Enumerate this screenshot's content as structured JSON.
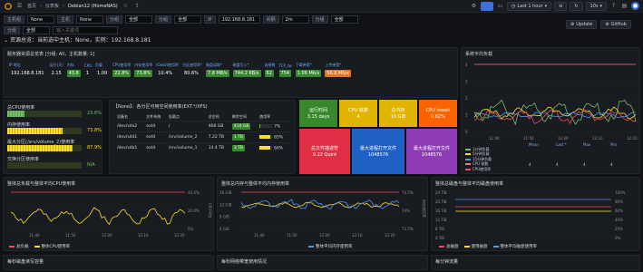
{
  "topbar": {
    "crumbs": [
      "首页",
      "仪表板",
      "Debian12 (HomeNAS)"
    ],
    "time_range": "Last 1 hour",
    "zoom": "",
    "refresh": "10s"
  },
  "variables": [
    {
      "label": "主机组",
      "value": "None"
    },
    {
      "label": "主机",
      "value": "None"
    },
    {
      "label": "分组",
      "value": "全部"
    },
    {
      "label": "分组",
      "value": "全部"
    },
    {
      "label": "IP",
      "value": "192.168.8.181"
    },
    {
      "label": "间隔",
      "value": "2m"
    },
    {
      "label": "分组",
      "value": "全部"
    },
    {
      "label": "分组",
      "value": "全部"
    }
  ],
  "search_placeholder": "输入关键词",
  "row1_title": "资源总览：当前选中主机：None，实例：192.168.8.181",
  "right_buttons": {
    "update": "Update",
    "github": "GitHub"
  },
  "resource_panel": {
    "title": "服务器资源总览表 [分组: All，主机数量: 1]",
    "headers": [
      "IP 地址",
      "运行(天)",
      "内存",
      "CPU",
      "负载",
      "CPU使用率",
      "内存使用率",
      "IOwait使用率",
      "分区使用率*",
      "磁盘读取*",
      "磁盘写入*",
      "连接数",
      "TCP_tw",
      "下载带宽*",
      "上传带宽*"
    ],
    "row": [
      "192.168.8.181",
      "2.15",
      "43.8",
      "1",
      "1.00",
      "22.8%",
      "73.8%",
      "10.4%",
      "80.6%",
      "7.8 MB/s",
      "744.2 KB/s",
      "62",
      "754",
      "1.06 Mb/s",
      "56.8 Mb/s"
    ]
  },
  "overall_panel": {
    "title": "整体资源使用率",
    "bars": [
      {
        "label": "总CPU使用率",
        "value": "23.6%",
        "pct": 23.6,
        "color": "#73bf69"
      },
      {
        "label": "内存使用率",
        "value": "73.8%",
        "pct": 73.8,
        "color": "#fade2a"
      },
      {
        "label": "最大分区(/srv/volume_2)使用率",
        "value": "87.9%",
        "pct": 87.9,
        "color": "#fade2a"
      },
      {
        "label": "交换分区使用率",
        "value": "N/A",
        "pct": 0,
        "color": "#73bf69"
      }
    ]
  },
  "disk_panel": {
    "title": "【None】：各分区可用空间使用率(EXT.*/XFS)",
    "headers": [
      "设备名",
      "文件系统",
      "挂载点",
      "总空间",
      "剩余空间",
      "使用率"
    ],
    "rows": [
      {
        "dev": "/dev/sda2",
        "fs": "ext4",
        "mount": "/",
        "total": "468 GB",
        "free": "410 GB",
        "used": "7%",
        "pct": 7,
        "color": "#73bf69"
      },
      {
        "dev": "/dev/sdd1",
        "fs": "ext4",
        "mount": "/srv/volume_2",
        "total": "7.22 TB",
        "free": "1 TB",
        "used": "85%",
        "pct": 85,
        "color": "#fade2a"
      },
      {
        "dev": "/dev/sdb1",
        "fs": "ext4",
        "mount": "/srv/volume_1",
        "total": "14.4 TB",
        "free": "3 TB",
        "used": "84%",
        "pct": 84,
        "color": "#fade2a"
      }
    ]
  },
  "tiles": [
    {
      "label": "运行时间",
      "value": "3.15 days",
      "color": "#37872d"
    },
    {
      "label": "CPU 核数",
      "value": "4",
      "color": "#e0b400"
    },
    {
      "label": "总内存",
      "value": "16 GiB",
      "color": "#e0b400"
    },
    {
      "label": "CPU iowait",
      "value": "0.62%",
      "color": "#fa6400"
    },
    {
      "label": "总文件描述符",
      "value": "9.22 Quint",
      "color": "#e02f44"
    },
    {
      "label": "最大进程打开文件",
      "value": "1048576",
      "color": "#1f60c4"
    },
    {
      "label": "最大进程打开文件",
      "value": "1048576",
      "color": "#8f3bb8"
    }
  ],
  "load_panel": {
    "title": "系统平均负载",
    "yticks": [
      "4",
      "3",
      "2",
      "1",
      "0"
    ],
    "xticks": [
      "11:40",
      "11:50",
      "12:00",
      "12:10",
      "12:20"
    ],
    "legend_headers": [
      "Mean",
      "Last *",
      "Max",
      "Min"
    ],
    "legend": [
      {
        "name": "1分钟负载",
        "color": "#73bf69",
        "vals": [
          "",
          "",
          "",
          ""
        ]
      },
      {
        "name": "5分钟负载",
        "color": "#fade2a",
        "vals": [
          "",
          "",
          "",
          ""
        ]
      },
      {
        "name": "15分钟负载",
        "color": "#5794f2",
        "vals": [
          "",
          "",
          "",
          ""
        ]
      },
      {
        "name": "CPU 核数",
        "color": "#ff7383",
        "vals": [
          "4",
          "4",
          "4",
          "4"
        ]
      },
      {
        "name": "CPU使用率",
        "color": "#f2495c",
        "vals": [
          "",
          "",
          "",
          ""
        ]
      }
    ]
  },
  "cpu_chart": {
    "title": "整体总负载与整体平均CPU使用率",
    "ylabels_right": [
      "40.0%",
      "20.0%",
      "0%"
    ],
    "yaxis_title": "CPU平均",
    "xticks": [
      "11:40",
      "11:50",
      "12:00",
      "12:10",
      "12:20"
    ],
    "legend": [
      {
        "name": "总负载",
        "color": "#f2495c"
      },
      {
        "name": "整体CPU使用率",
        "color": "#fade2a"
      }
    ]
  },
  "mem_chart": {
    "title": "整体总内存与整体平均内存使用率",
    "yticks": [
      "16 GiB",
      "12 GiB",
      "8 GiB",
      "4 GiB"
    ],
    "ylabels_right": [
      "74.5%",
      "74%",
      "73.5%"
    ],
    "yaxis_title": "内存使用率",
    "xticks": [
      "11:40",
      "11:50",
      "12:00",
      "12:10",
      "12:20"
    ],
    "legend": [
      {
        "name": "总内存",
        "color": "#f2495c"
      },
      {
        "name": "使用内存",
        "color": "#fade2a"
      },
      {
        "name": "整体平均内存使用率",
        "color": "#5794f2"
      }
    ]
  },
  "disk_chart": {
    "title": "整体总磁盘与整体平均磁盘使用率",
    "yticks": [
      "24 TiB",
      "20 TiB",
      "16 TiB",
      "12 TiB",
      "8 TiB",
      "4 TiB"
    ],
    "ylabels_right": [
      "100%",
      "80%",
      "60%",
      "40%",
      "20%",
      "0%"
    ],
    "legend": [
      {
        "name": "总磁盘",
        "color": "#f2495c"
      },
      {
        "name": "使用磁盘",
        "color": "#fade2a"
      },
      {
        "name": "整体平均磁盘使用率",
        "color": "#5794f2"
      }
    ]
  },
  "bottom_titles": [
    "每秒磁盘读写容量",
    "每秒网络带宽使用情况",
    "每分钟流量"
  ]
}
